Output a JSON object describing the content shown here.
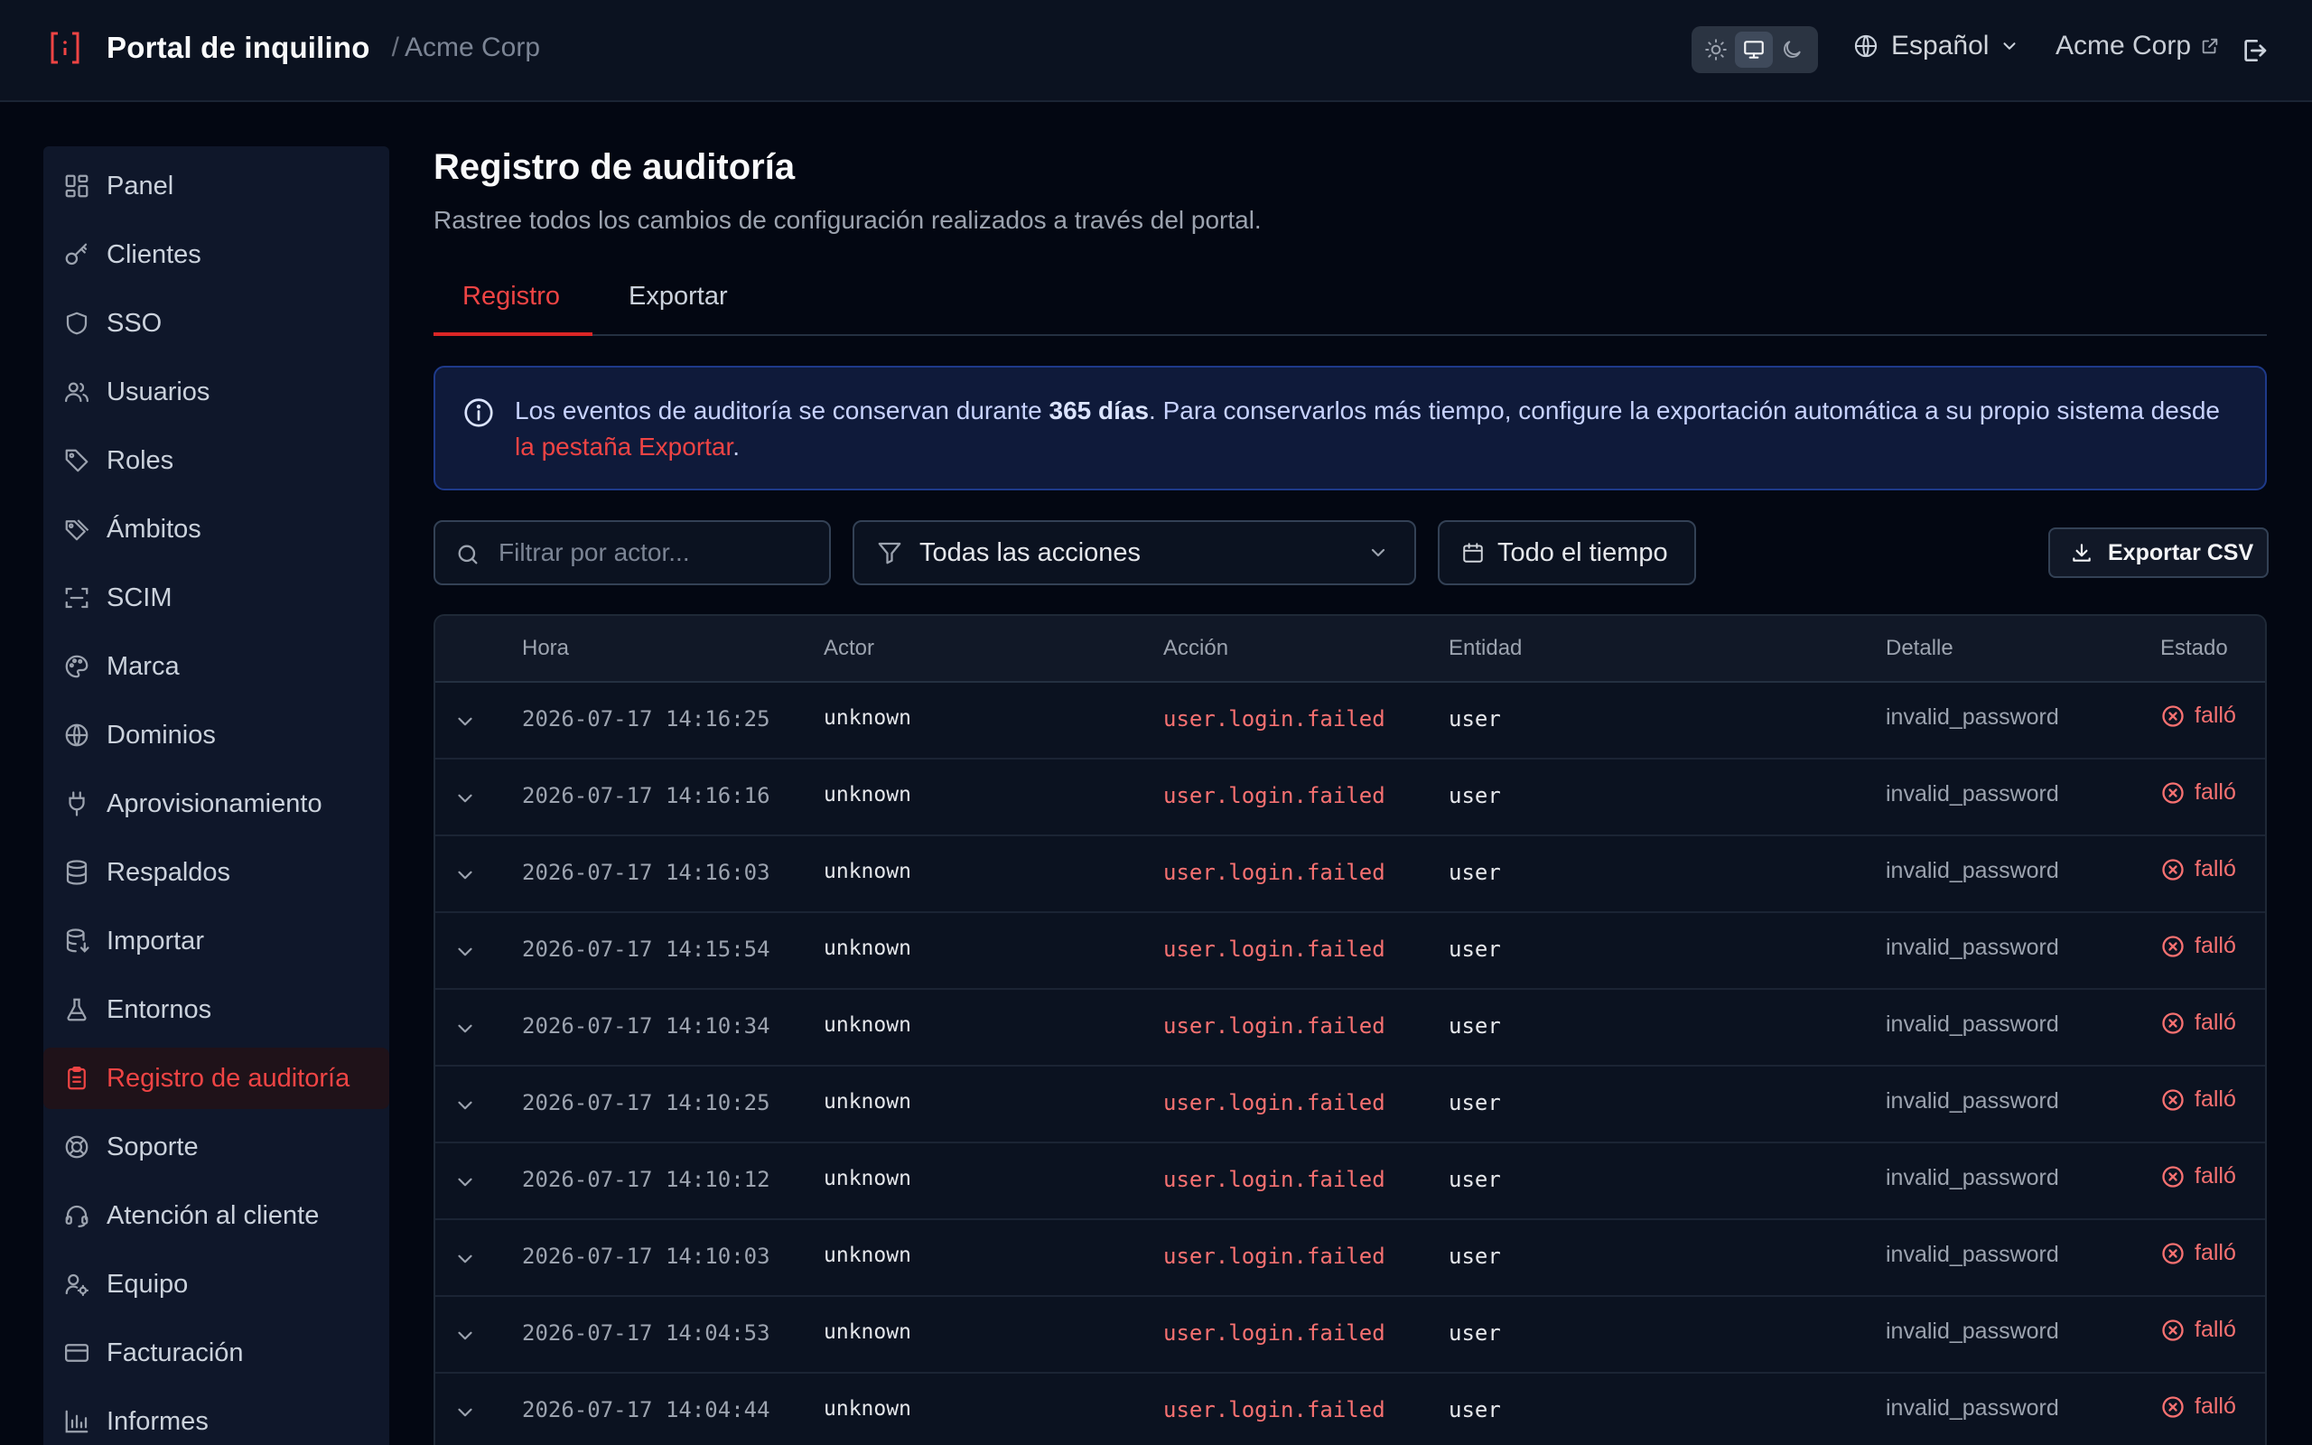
{
  "header": {
    "app_title": "Portal de inquilino",
    "separator": "/",
    "tenant": "Acme Corp",
    "language": "Español",
    "tenant_link": "Acme Corp"
  },
  "sidebar": {
    "items": [
      {
        "label": "Panel",
        "icon": "dashboard-icon"
      },
      {
        "label": "Clientes",
        "icon": "key-icon"
      },
      {
        "label": "SSO",
        "icon": "shield-icon"
      },
      {
        "label": "Usuarios",
        "icon": "users-icon"
      },
      {
        "label": "Roles",
        "icon": "tag-icon"
      },
      {
        "label": "Ámbitos",
        "icon": "tags-icon"
      },
      {
        "label": "SCIM",
        "icon": "scan-icon"
      },
      {
        "label": "Marca",
        "icon": "palette-icon"
      },
      {
        "label": "Dominios",
        "icon": "globe-icon"
      },
      {
        "label": "Aprovisionamiento",
        "icon": "plug-icon"
      },
      {
        "label": "Respaldos",
        "icon": "database-icon"
      },
      {
        "label": "Importar",
        "icon": "database-import-icon"
      },
      {
        "label": "Entornos",
        "icon": "flask-icon"
      },
      {
        "label": "Registro de auditoría",
        "icon": "clipboard-icon",
        "active": true
      },
      {
        "label": "Soporte",
        "icon": "lifebuoy-icon"
      },
      {
        "label": "Atención al cliente",
        "icon": "headset-icon"
      },
      {
        "label": "Equipo",
        "icon": "user-cog-icon"
      },
      {
        "label": "Facturación",
        "icon": "credit-card-icon"
      },
      {
        "label": "Informes",
        "icon": "bar-chart-icon"
      }
    ]
  },
  "page": {
    "title": "Registro de auditoría",
    "subtitle": "Rastree todos los cambios de configuración realizados a través del portal."
  },
  "tabs": [
    {
      "label": "Registro",
      "active": true
    },
    {
      "label": "Exportar",
      "active": false
    }
  ],
  "info": {
    "text_before": "Los eventos de auditoría se conservan durante ",
    "retention": "365 días",
    "text_middle": ". Para conservarlos más tiempo, configure la exportación automática a su propio sistema desde ",
    "link": "la pestaña Exportar",
    "text_after": "."
  },
  "filters": {
    "actor_placeholder": "Filtrar por actor...",
    "actions_selected": "Todas las acciones",
    "date_range": "Todo el tiempo",
    "export_label": "Exportar CSV"
  },
  "table": {
    "columns": [
      "Hora",
      "Actor",
      "Acción",
      "Entidad",
      "Detalle",
      "Estado"
    ],
    "rows": [
      {
        "time": "2026-07-17 14:16:25",
        "actor": "unknown",
        "action": "user.login.failed",
        "entity": "user",
        "detail": "invalid_password",
        "status": "falló"
      },
      {
        "time": "2026-07-17 14:16:16",
        "actor": "unknown",
        "action": "user.login.failed",
        "entity": "user",
        "detail": "invalid_password",
        "status": "falló"
      },
      {
        "time": "2026-07-17 14:16:03",
        "actor": "unknown",
        "action": "user.login.failed",
        "entity": "user",
        "detail": "invalid_password",
        "status": "falló"
      },
      {
        "time": "2026-07-17 14:15:54",
        "actor": "unknown",
        "action": "user.login.failed",
        "entity": "user",
        "detail": "invalid_password",
        "status": "falló"
      },
      {
        "time": "2026-07-17 14:10:34",
        "actor": "unknown",
        "action": "user.login.failed",
        "entity": "user",
        "detail": "invalid_password",
        "status": "falló"
      },
      {
        "time": "2026-07-17 14:10:25",
        "actor": "unknown",
        "action": "user.login.failed",
        "entity": "user",
        "detail": "invalid_password",
        "status": "falló"
      },
      {
        "time": "2026-07-17 14:10:12",
        "actor": "unknown",
        "action": "user.login.failed",
        "entity": "user",
        "detail": "invalid_password",
        "status": "falló"
      },
      {
        "time": "2026-07-17 14:10:03",
        "actor": "unknown",
        "action": "user.login.failed",
        "entity": "user",
        "detail": "invalid_password",
        "status": "falló"
      },
      {
        "time": "2026-07-17 14:04:53",
        "actor": "unknown",
        "action": "user.login.failed",
        "entity": "user",
        "detail": "invalid_password",
        "status": "falló"
      },
      {
        "time": "2026-07-17 14:04:44",
        "actor": "unknown",
        "action": "user.login.failed",
        "entity": "user",
        "detail": "invalid_password",
        "status": "falló"
      }
    ]
  },
  "colors": {
    "accent": "#ef4444",
    "background": "#030712",
    "sidebar": "#0f172a",
    "info_bg": "#0f1a3a",
    "info_border": "#1e3a8a"
  }
}
